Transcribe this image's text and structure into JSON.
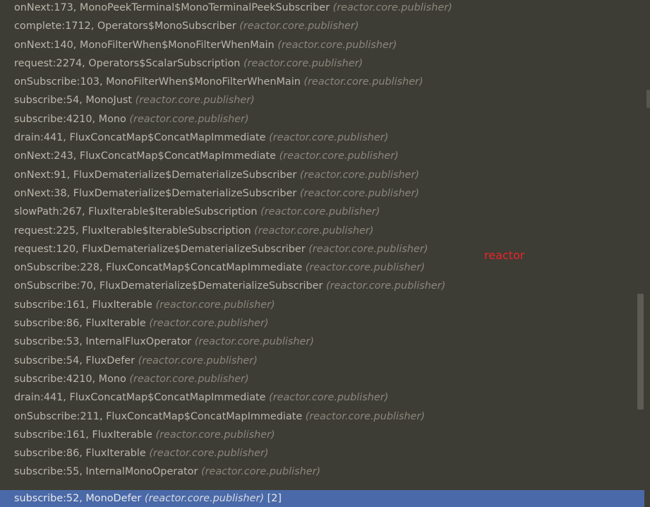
{
  "frames": [
    {
      "method": "onNext:173, MonoPeekTerminal$MonoTerminalPeekSubscriber",
      "pkg": "(reactor.core.publisher)"
    },
    {
      "method": "complete:1712, Operators$MonoSubscriber",
      "pkg": "(reactor.core.publisher)"
    },
    {
      "method": "onNext:140, MonoFilterWhen$MonoFilterWhenMain",
      "pkg": "(reactor.core.publisher)"
    },
    {
      "method": "request:2274, Operators$ScalarSubscription",
      "pkg": "(reactor.core.publisher)"
    },
    {
      "method": "onSubscribe:103, MonoFilterWhen$MonoFilterWhenMain",
      "pkg": "(reactor.core.publisher)"
    },
    {
      "method": "subscribe:54, MonoJust",
      "pkg": "(reactor.core.publisher)"
    },
    {
      "method": "subscribe:4210, Mono",
      "pkg": "(reactor.core.publisher)"
    },
    {
      "method": "drain:441, FluxConcatMap$ConcatMapImmediate",
      "pkg": "(reactor.core.publisher)"
    },
    {
      "method": "onNext:243, FluxConcatMap$ConcatMapImmediate",
      "pkg": "(reactor.core.publisher)"
    },
    {
      "method": "onNext:91, FluxDematerialize$DematerializeSubscriber",
      "pkg": "(reactor.core.publisher)"
    },
    {
      "method": "onNext:38, FluxDematerialize$DematerializeSubscriber",
      "pkg": "(reactor.core.publisher)"
    },
    {
      "method": "slowPath:267, FluxIterable$IterableSubscription",
      "pkg": "(reactor.core.publisher)"
    },
    {
      "method": "request:225, FluxIterable$IterableSubscription",
      "pkg": "(reactor.core.publisher)"
    },
    {
      "method": "request:120, FluxDematerialize$DematerializeSubscriber",
      "pkg": "(reactor.core.publisher)"
    },
    {
      "method": "onSubscribe:228, FluxConcatMap$ConcatMapImmediate",
      "pkg": "(reactor.core.publisher)"
    },
    {
      "method": "onSubscribe:70, FluxDematerialize$DematerializeSubscriber",
      "pkg": "(reactor.core.publisher)"
    },
    {
      "method": "subscribe:161, FluxIterable",
      "pkg": "(reactor.core.publisher)"
    },
    {
      "method": "subscribe:86, FluxIterable",
      "pkg": "(reactor.core.publisher)"
    },
    {
      "method": "subscribe:53, InternalFluxOperator",
      "pkg": "(reactor.core.publisher)"
    },
    {
      "method": "subscribe:54, FluxDefer",
      "pkg": "(reactor.core.publisher)"
    },
    {
      "method": "subscribe:4210, Mono",
      "pkg": "(reactor.core.publisher)"
    },
    {
      "method": "drain:441, FluxConcatMap$ConcatMapImmediate",
      "pkg": "(reactor.core.publisher)"
    },
    {
      "method": "onSubscribe:211, FluxConcatMap$ConcatMapImmediate",
      "pkg": "(reactor.core.publisher)"
    },
    {
      "method": "subscribe:161, FluxIterable",
      "pkg": "(reactor.core.publisher)"
    },
    {
      "method": "subscribe:86, FluxIterable",
      "pkg": "(reactor.core.publisher)"
    },
    {
      "method": "subscribe:55, InternalMonoOperator",
      "pkg": "(reactor.core.publisher)"
    }
  ],
  "selected_frame": {
    "method": "subscribe:52, MonoDefer",
    "pkg": "(reactor.core.publisher)",
    "count": "[2]"
  },
  "annotation": "reactor",
  "colors": {
    "background": "#3e3d35",
    "text": "#b9b6ab",
    "package": "#8a877c",
    "selection": "#4a69a8",
    "annotation": "#e8252a"
  }
}
